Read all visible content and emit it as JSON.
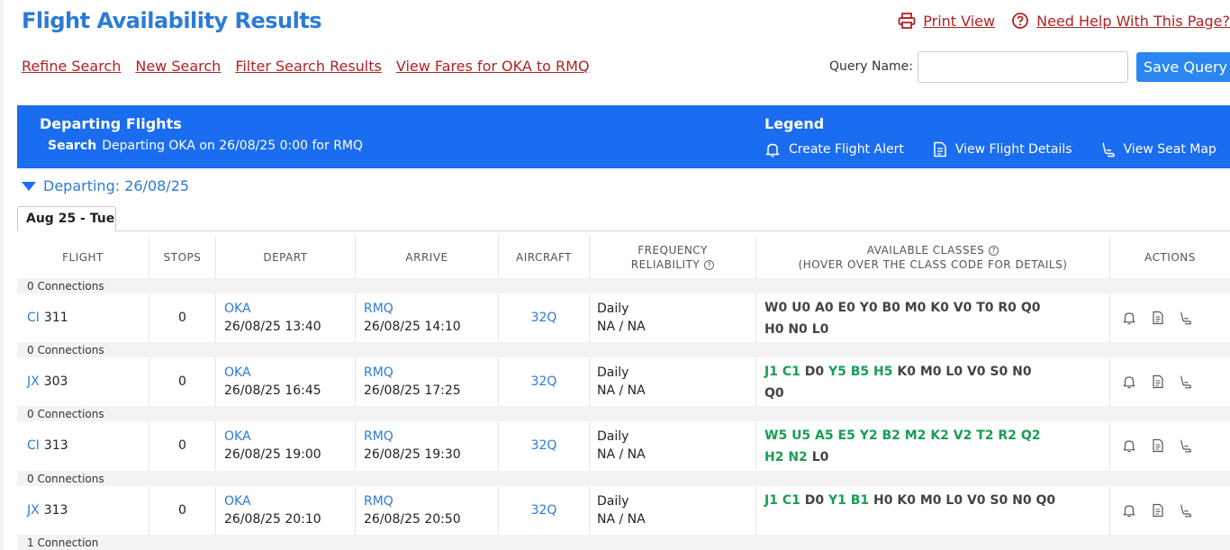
{
  "page": {
    "title": "Flight Availability Results",
    "print_view": "Print View",
    "help": "Need Help With This Page?"
  },
  "nav": {
    "links": [
      "Refine Search",
      "New Search",
      "Filter Search Results",
      "View Fares for OKA to RMQ"
    ],
    "query_label": "Query Name:",
    "query_value": "",
    "save_query": "Save Query"
  },
  "banner": {
    "title": "Departing Flights",
    "search_label": "Search",
    "search_text": "Departing OKA on 26/08/25 0:00 for RMQ",
    "legend_title": "Legend",
    "legend": [
      "Create Flight Alert",
      "View Flight Details",
      "View Seat Map"
    ]
  },
  "departing_header": "Departing: 26/08/25",
  "tab": "Aug 25 - Tue",
  "columns": {
    "flight": "FLIGHT",
    "stops": "STOPS",
    "depart": "DEPART",
    "arrive": "ARRIVE",
    "aircraft": "AIRCRAFT",
    "freq_line1": "FREQUENCY",
    "freq_line2": "RELIABILITY",
    "classes_line1": "AVAILABLE CLASSES",
    "classes_line2": "(HOVER OVER THE CLASS CODE FOR DETAILS)",
    "actions": "ACTIONS"
  },
  "colors": {
    "accent": "#2b7bd8",
    "banner": "#1a6cf0",
    "link": "#b22222",
    "available": "#1a9e52"
  },
  "flights": [
    {
      "connections": "0 Connections",
      "carrier": "CI",
      "number": "311",
      "stops": "0",
      "depart_code": "OKA",
      "depart_time": "26/08/25 13:40",
      "arrive_code": "RMQ",
      "arrive_time": "26/08/25 14:10",
      "aircraft": "32Q",
      "frequency": "Daily",
      "reliability": "NA / NA",
      "classes_lines": [
        [
          {
            "code": "W0",
            "available": false
          },
          {
            "code": "U0",
            "available": false
          },
          {
            "code": "A0",
            "available": false
          },
          {
            "code": "E0",
            "available": false
          },
          {
            "code": "Y0",
            "available": false
          },
          {
            "code": "B0",
            "available": false
          },
          {
            "code": "M0",
            "available": false
          },
          {
            "code": "K0",
            "available": false
          },
          {
            "code": "V0",
            "available": false
          },
          {
            "code": "T0",
            "available": false
          },
          {
            "code": "R0",
            "available": false
          },
          {
            "code": "Q0",
            "available": false
          }
        ],
        [
          {
            "code": "H0",
            "available": false
          },
          {
            "code": "N0",
            "available": false
          },
          {
            "code": "L0",
            "available": false
          }
        ]
      ]
    },
    {
      "connections": "0 Connections",
      "carrier": "JX",
      "number": "303",
      "stops": "0",
      "depart_code": "OKA",
      "depart_time": "26/08/25 16:45",
      "arrive_code": "RMQ",
      "arrive_time": "26/08/25 17:25",
      "aircraft": "32Q",
      "frequency": "Daily",
      "reliability": "NA / NA",
      "classes_lines": [
        [
          {
            "code": "J1",
            "available": true
          },
          {
            "code": "C1",
            "available": true
          },
          {
            "code": "D0",
            "available": false
          },
          {
            "code": "Y5",
            "available": true
          },
          {
            "code": "B5",
            "available": true
          },
          {
            "code": "H5",
            "available": true
          },
          {
            "code": "K0",
            "available": false
          },
          {
            "code": "M0",
            "available": false
          },
          {
            "code": "L0",
            "available": false
          },
          {
            "code": "V0",
            "available": false
          },
          {
            "code": "S0",
            "available": false
          },
          {
            "code": "N0",
            "available": false
          }
        ],
        [
          {
            "code": "Q0",
            "available": false
          }
        ]
      ]
    },
    {
      "connections": "0 Connections",
      "carrier": "CI",
      "number": "313",
      "stops": "0",
      "depart_code": "OKA",
      "depart_time": "26/08/25 19:00",
      "arrive_code": "RMQ",
      "arrive_time": "26/08/25 19:30",
      "aircraft": "32Q",
      "frequency": "Daily",
      "reliability": "NA / NA",
      "classes_lines": [
        [
          {
            "code": "W5",
            "available": true
          },
          {
            "code": "U5",
            "available": true
          },
          {
            "code": "A5",
            "available": true
          },
          {
            "code": "E5",
            "available": true
          },
          {
            "code": "Y2",
            "available": true
          },
          {
            "code": "B2",
            "available": true
          },
          {
            "code": "M2",
            "available": true
          },
          {
            "code": "K2",
            "available": true
          },
          {
            "code": "V2",
            "available": true
          },
          {
            "code": "T2",
            "available": true
          },
          {
            "code": "R2",
            "available": true
          },
          {
            "code": "Q2",
            "available": true
          }
        ],
        [
          {
            "code": "H2",
            "available": true
          },
          {
            "code": "N2",
            "available": true
          },
          {
            "code": "L0",
            "available": false
          }
        ]
      ]
    },
    {
      "connections": "0 Connections",
      "carrier": "JX",
      "number": "313",
      "stops": "0",
      "depart_code": "OKA",
      "depart_time": "26/08/25 20:10",
      "arrive_code": "RMQ",
      "arrive_time": "26/08/25 20:50",
      "aircraft": "32Q",
      "frequency": "Daily",
      "reliability": "NA / NA",
      "classes_lines": [
        [
          {
            "code": "J1",
            "available": true
          },
          {
            "code": "C1",
            "available": true
          },
          {
            "code": "D0",
            "available": false
          },
          {
            "code": "Y1",
            "available": true
          },
          {
            "code": "B1",
            "available": true
          },
          {
            "code": "H0",
            "available": false
          },
          {
            "code": "K0",
            "available": false
          },
          {
            "code": "M0",
            "available": false
          },
          {
            "code": "L0",
            "available": false
          },
          {
            "code": "V0",
            "available": false
          },
          {
            "code": "S0",
            "available": false
          },
          {
            "code": "N0",
            "available": false
          },
          {
            "code": "Q0",
            "available": false
          }
        ]
      ]
    }
  ],
  "next_connections": "1 Connection"
}
